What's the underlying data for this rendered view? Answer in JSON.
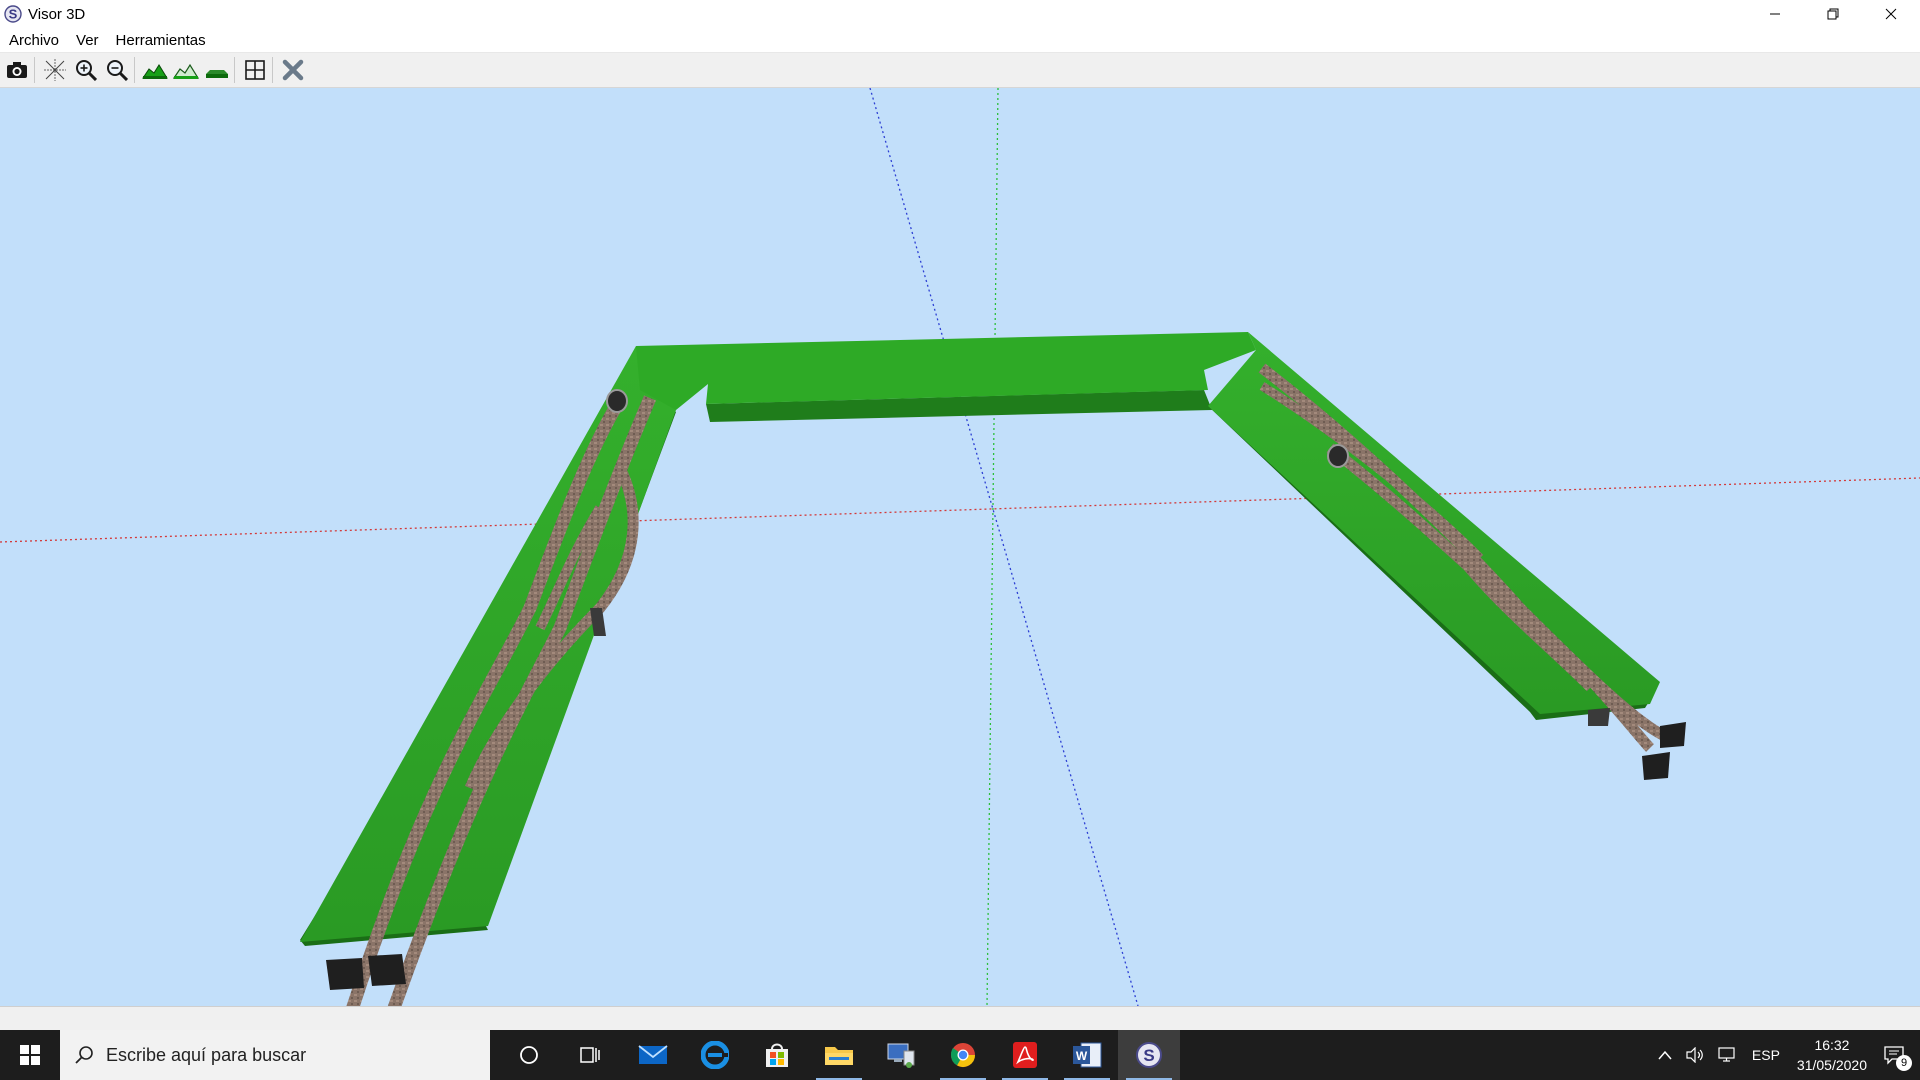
{
  "window": {
    "title": "Visor 3D",
    "app_icon_letter": "S",
    "controls": [
      "minimize-icon",
      "restore-icon",
      "close-icon"
    ]
  },
  "menu": {
    "items": [
      "Archivo",
      "Ver",
      "Herramientas"
    ]
  },
  "toolbar": {
    "buttons": [
      {
        "name": "camera-button",
        "icon": "camera-icon"
      },
      {
        "name": "axes-button",
        "icon": "axes-icon"
      },
      {
        "name": "zoom-in-button",
        "icon": "zoom-in-icon"
      },
      {
        "name": "zoom-out-button",
        "icon": "zoom-out-icon"
      },
      {
        "name": "terrain-view-1-button",
        "icon": "terrain-icon"
      },
      {
        "name": "terrain-view-2-button",
        "icon": "terrain-outline-icon"
      },
      {
        "name": "terrain-flat-button",
        "icon": "terrain-flat-icon"
      },
      {
        "name": "fit-view-button",
        "icon": "fit-view-icon"
      },
      {
        "name": "delete-button",
        "icon": "delete-icon"
      }
    ]
  },
  "viewport": {
    "background_color": "#c2dffa",
    "terrain_color": "#2f9e29",
    "axis_colors": {
      "x": "#d33a3a",
      "y": "#2cbf3a",
      "z": "#2c3fd3"
    }
  },
  "taskbar": {
    "search_placeholder": "Escribe aquí para buscar",
    "language": "ESP",
    "time": "16:32",
    "date": "31/05/2020",
    "notification_count": "9"
  }
}
